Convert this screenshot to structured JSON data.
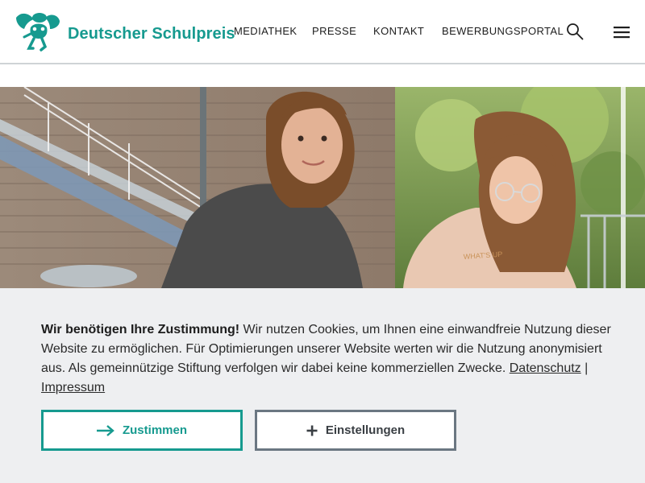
{
  "header": {
    "brand": "Deutscher Schulpreis",
    "nav": [
      "MEDIATHEK",
      "PRESSE",
      "KONTAKT",
      "BEWERBUNGSPORTAL"
    ],
    "search_icon": "search-icon",
    "menu_icon": "hamburger-menu-icon"
  },
  "colors": {
    "brand": "#169a8f",
    "consent_bg": "#eeeff1",
    "secondary_button": "#6b7782"
  },
  "consent": {
    "heading": "Wir benötigen Ihre Zustimmung!",
    "body": " Wir nutzen Cookies, um Ihnen eine einwandfreie Nutzung dieser Website zu ermöglichen. Für Optimierungen unserer Website werten wir die Nutzung anonymisiert aus. Als gemeinnützige Stiftung verfolgen wir dabei keine kommerziellen Zwecke. ",
    "privacy_link": "Datenschutz",
    "separator": " | ",
    "imprint_link": "Impressum",
    "accept_label": "Zustimmen",
    "accept_icon": "arrow-right-icon",
    "settings_label": "Einstellungen",
    "settings_icon": "plus-icon"
  }
}
